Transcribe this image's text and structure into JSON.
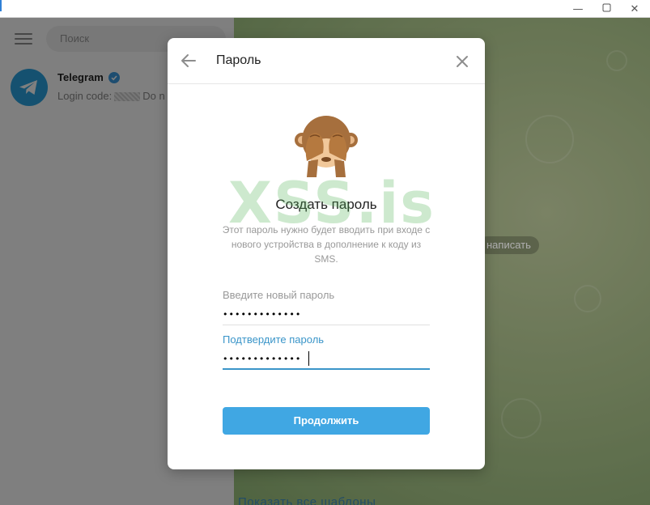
{
  "window": {
    "minimize_icon": "minimize-icon",
    "maximize_icon": "maximize-icon",
    "close_icon": "close-icon"
  },
  "sidebar": {
    "search_placeholder": "Поиск",
    "chats": [
      {
        "name": "Telegram",
        "verified": true,
        "preview_prefix": "Login code:",
        "preview_suffix": "Do n"
      }
    ]
  },
  "chat_area": {
    "write_prompt": "написать",
    "bottom_link": "Показать все шаблоны"
  },
  "modal": {
    "title": "Пароль",
    "heading": "Создать пароль",
    "description": "Этот пароль нужно будет вводить при входе с нового устройства в дополнение к коду из SMS.",
    "new_password_label": "Введите новый пароль",
    "new_password_value": "•••••••••••••",
    "confirm_password_label": "Подтвердите пароль",
    "confirm_password_value": "•••••••••••••",
    "continue_label": "Продолжить"
  },
  "watermark": "XSS.is",
  "colors": {
    "accent": "#40a7e3",
    "focus_underline": "#3a95c9",
    "avatar": "#2aa3e0"
  }
}
